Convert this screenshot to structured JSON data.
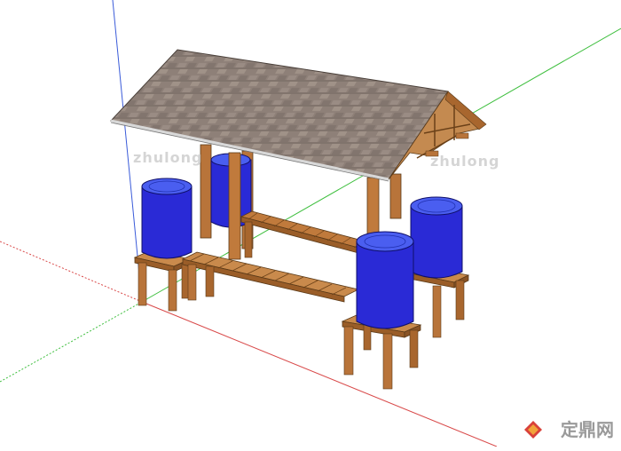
{
  "watermarks": [
    "zhulong",
    "zhulong"
  ],
  "brand": {
    "text": "定鼎网",
    "logo_icon": "diamond-logo-icon",
    "color": "#d9413a"
  },
  "axes_colors": {
    "red": "#d94a4a",
    "green": "#3fbf3f",
    "blue": "#3a5bd9"
  },
  "colors": {
    "roof": "#8d7f76",
    "wood": "#b8743a",
    "wood_dark": "#8a5426",
    "barrel": "#2a2ad6",
    "barrel_top": "#4a5ef0"
  }
}
